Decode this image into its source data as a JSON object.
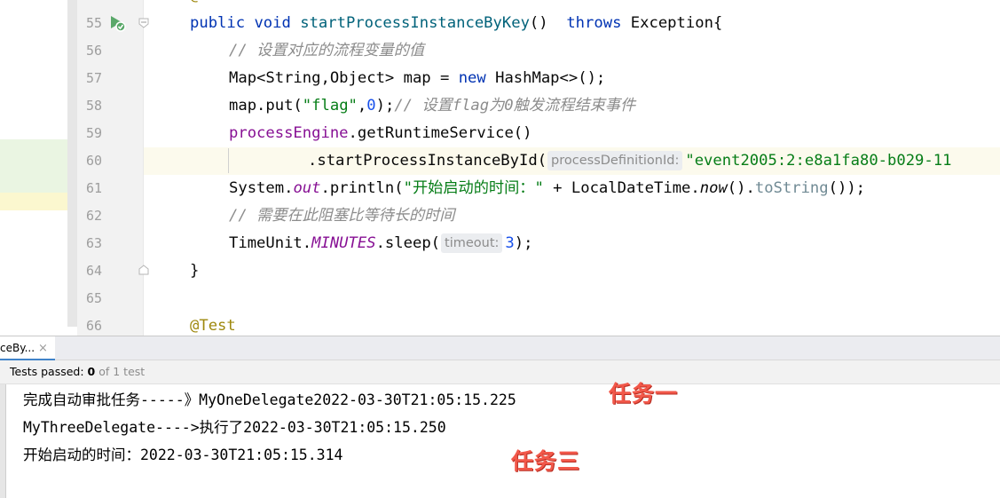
{
  "editor": {
    "lines": [
      {
        "num": "55"
      },
      {
        "num": "56"
      },
      {
        "num": "57"
      },
      {
        "num": "58"
      },
      {
        "num": "59"
      },
      {
        "num": "60"
      },
      {
        "num": "61"
      },
      {
        "num": "62"
      },
      {
        "num": "63"
      },
      {
        "num": "64"
      },
      {
        "num": "65"
      },
      {
        "num": "66"
      }
    ],
    "top_partial_text": "@Test",
    "l55": {
      "kw1": "public",
      "kw2": "void",
      "method": "startProcessInstanceByKey",
      "paren": "()",
      "throws": "throws",
      "exc": "Exception{"
    },
    "l56": {
      "comment": "// 设置对应的流程变量的值"
    },
    "l57": {
      "type": "Map<String,Object> map = ",
      "new": "new",
      "rest": " HashMap<>();"
    },
    "l58": {
      "pre": "map.put(",
      "str": "\"flag\"",
      "comma": ",",
      "num": "0",
      "close": ");",
      "comment": "// 设置flag为0触发流程结束事件"
    },
    "l59": {
      "field": "processEngine",
      "rest": ".getRuntimeService()"
    },
    "l60": {
      "call": ".startProcessInstanceById(",
      "hint": "processDefinitionId:",
      "str": "\"event2005:2:e8a1fa80-b029-11"
    },
    "l61": {
      "sys": "System.",
      "out": "out",
      "println": ".println(",
      "str": "\"开始启动的时间：\"",
      "plus": " + LocalDateTime.",
      "now": "now",
      "close1": "().",
      "tostr": "toString",
      "close2": "());"
    },
    "l62": {
      "comment": "// 需要在此阻塞比等待长的时间"
    },
    "l63": {
      "pre": "TimeUnit.",
      "minutes": "MINUTES",
      "sleep": ".sleep(",
      "hint": "timeout:",
      "num": "3",
      "close": ");"
    },
    "l64": {
      "brace": "}"
    },
    "l66": {
      "anno": "@Test"
    }
  },
  "tabbar": {
    "tab_label": "ceBy...",
    "close": "×"
  },
  "status": {
    "label": "Tests passed:",
    "passed": "0",
    "rest": "of 1 test"
  },
  "console": {
    "lines": [
      "完成自动审批任务-----》MyOneDelegate2022-03-30T21:05:15.225",
      "MyThreeDelegate---->执行了2022-03-30T21:05:15.250",
      "开始启动的时间：2022-03-30T21:05:15.314"
    ]
  },
  "annotations": {
    "task1": "任务一",
    "task3": "任务三"
  },
  "colors": {
    "keyword": "#0033b3",
    "string": "#067d17",
    "comment": "#8c8c8c",
    "annotation_note": "#f2584a",
    "diff_added": "#e9f5e3",
    "current_line": "#fcfaed"
  }
}
